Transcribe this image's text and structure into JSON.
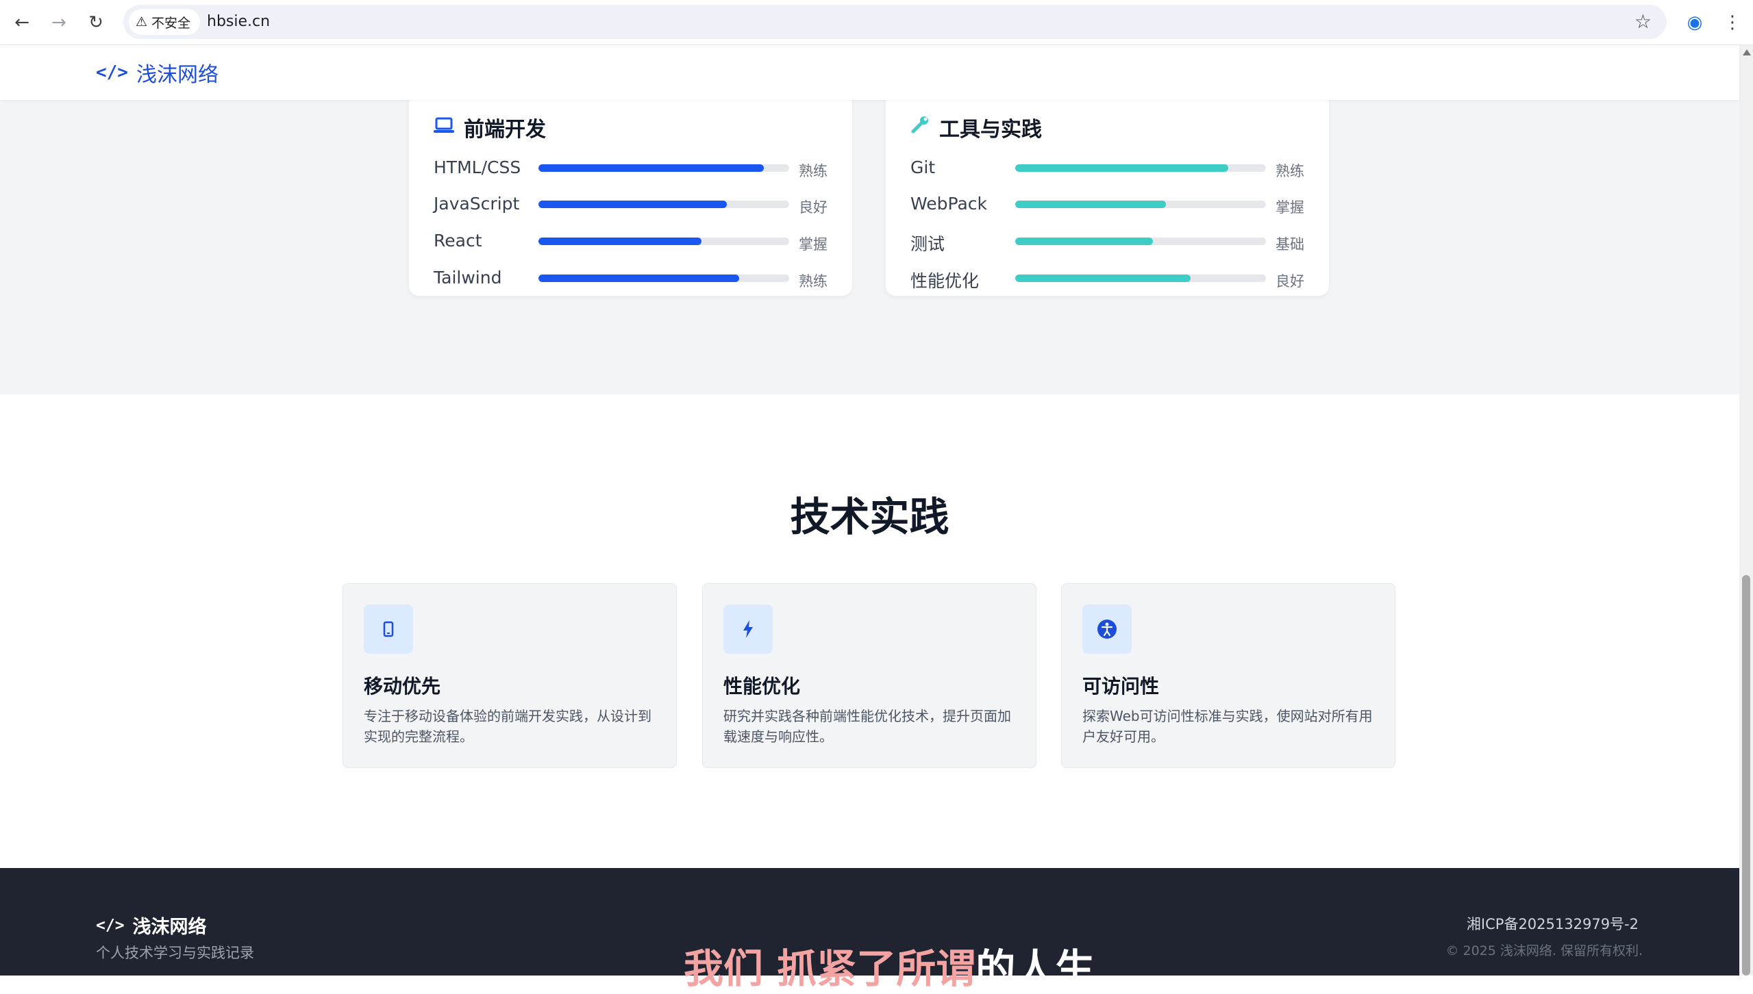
{
  "browser": {
    "security_label": "不安全",
    "url": "hbsie.cn"
  },
  "site": {
    "brand": "浅沫网络"
  },
  "skills": [
    {
      "title": "前端开发",
      "icon": "laptop-icon",
      "color": "#1a56f0",
      "items": [
        {
          "name": "HTML/CSS",
          "level": "熟练",
          "percent": 90
        },
        {
          "name": "JavaScript",
          "level": "良好",
          "percent": 75
        },
        {
          "name": "React",
          "level": "掌握",
          "percent": 65
        },
        {
          "name": "Tailwind",
          "level": "熟练",
          "percent": 80
        }
      ]
    },
    {
      "title": "工具与实践",
      "icon": "wrench-icon",
      "color": "#3ecdc6",
      "items": [
        {
          "name": "Git",
          "level": "熟练",
          "percent": 85
        },
        {
          "name": "WebPack",
          "level": "掌握",
          "percent": 60
        },
        {
          "name": "测试",
          "level": "基础",
          "percent": 55
        },
        {
          "name": "性能优化",
          "level": "良好",
          "percent": 70
        }
      ]
    }
  ],
  "practice": {
    "title": "技术实践",
    "cards": [
      {
        "title": "移动优先",
        "desc": "专注于移动设备体验的前端开发实践，从设计到实现的完整流程。",
        "icon": "mobile-icon"
      },
      {
        "title": "性能优化",
        "desc": "研究并实践各种前端性能优化技术，提升页面加载速度与响应性。",
        "icon": "bolt-icon"
      },
      {
        "title": "可访问性",
        "desc": "探索Web可访问性标准与实践，使网站对所有用户友好可用。",
        "icon": "accessibility-icon"
      }
    ]
  },
  "footer": {
    "brand": "浅沫网络",
    "tagline": "个人技术学习与实践记录",
    "slogan_highlight": "我们 抓紧了所谓",
    "slogan_rest": "的人生",
    "icp": "湘ICP备2025132979号-2",
    "copyright": "© 2025 浅沫网络. 保留所有权利."
  }
}
